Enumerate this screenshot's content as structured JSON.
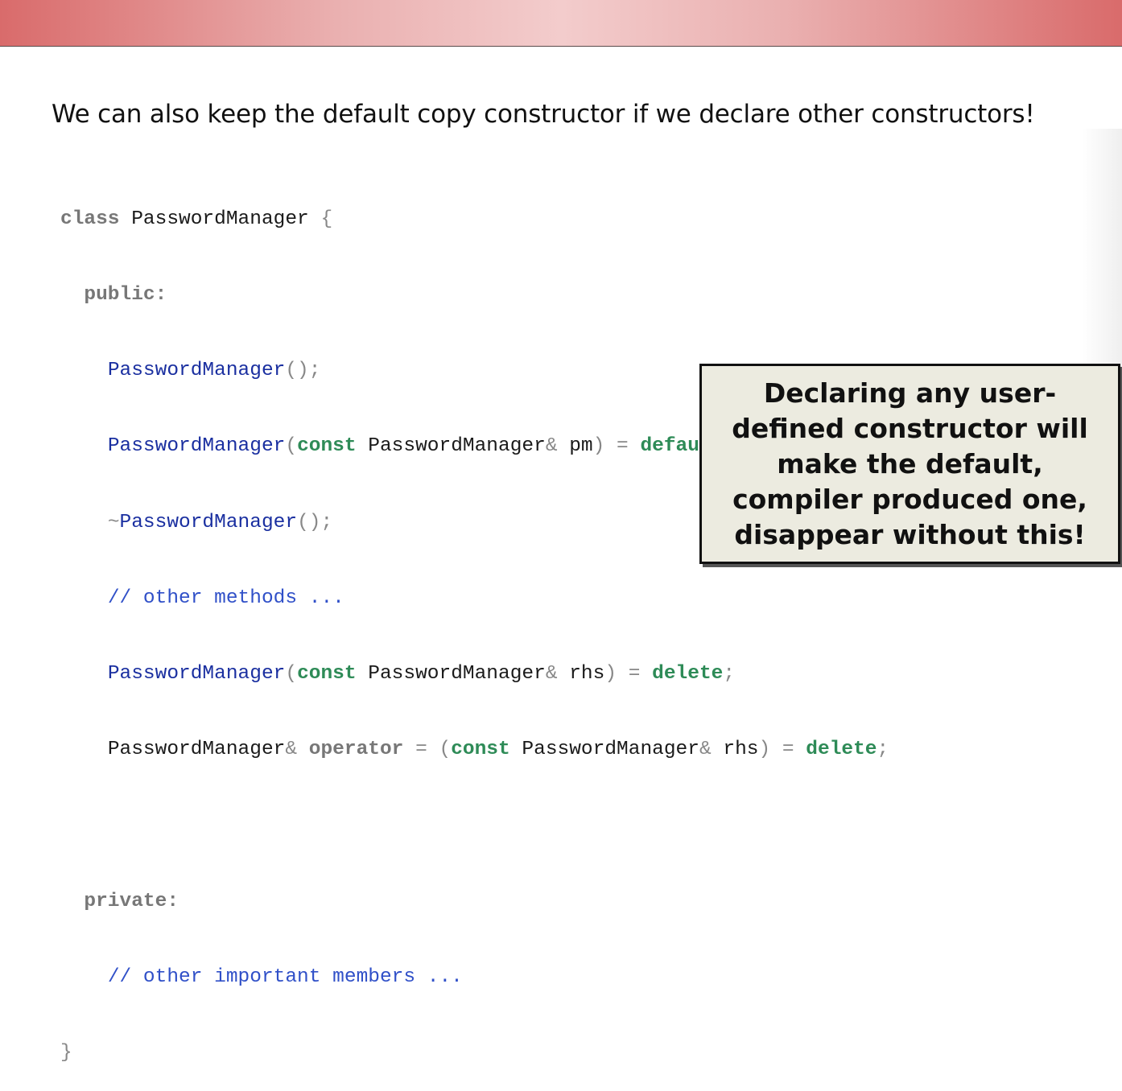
{
  "header": {
    "color_left": "#d96b6b",
    "color_center": "#f3cccc"
  },
  "title": "We can also keep the default copy constructor if we declare other constructors!",
  "code": {
    "class_kw": "class",
    "class_name": " PasswordManager ",
    "brace_open": "{",
    "public_kw": "public:",
    "ctor_name": "PasswordManager",
    "empty_parens": "();",
    "open_paren": "(",
    "const_kw": "const",
    "type_name": " PasswordManager",
    "amp": "&",
    "param_pm": " pm",
    "param_rhs": " rhs",
    "close_paren": ")",
    "equals": " = ",
    "default_kw": "default",
    "delete_kw": "delete",
    "semicolon": ";",
    "tilde": "~",
    "comment_methods": "// other methods ...",
    "ref_type": "PasswordManager",
    "operator_kw": "operator",
    "op_equals": " = ",
    "private_kw": "private:",
    "comment_members": "// other important members ...",
    "brace_close": "}"
  },
  "callout": {
    "text": "Declaring any user-defined constructor will make the default, compiler produced one, disappear without this!"
  }
}
